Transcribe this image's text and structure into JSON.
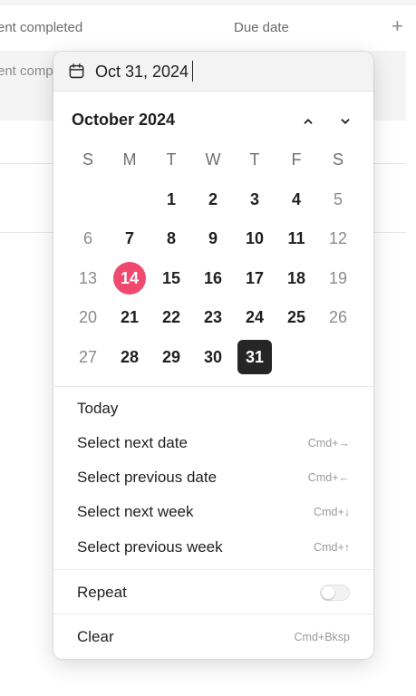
{
  "background": {
    "columns": {
      "col1": "ent completed",
      "col2": "Due date",
      "add_icon": "+"
    },
    "selected_row_text": "ent comp"
  },
  "datepicker": {
    "input_value": "Oct 31, 2024",
    "month_title": "October 2024",
    "weekdays": [
      "S",
      "M",
      "T",
      "W",
      "T",
      "F",
      "S"
    ],
    "days": {
      "d1": "1",
      "d2": "2",
      "d3": "3",
      "d4": "4",
      "d5": "5",
      "d6": "6",
      "d7": "7",
      "d8": "8",
      "d9": "9",
      "d10": "10",
      "d11": "11",
      "d12": "12",
      "d13": "13",
      "d14": "14",
      "d15": "15",
      "d16": "16",
      "d17": "17",
      "d18": "18",
      "d19": "19",
      "d20": "20",
      "d21": "21",
      "d22": "22",
      "d23": "23",
      "d24": "24",
      "d25": "25",
      "d26": "26",
      "d27": "27",
      "d28": "28",
      "d29": "29",
      "d30": "30",
      "d31": "31"
    },
    "today_day": "14",
    "selected_day": "31",
    "menu": {
      "today": "Today",
      "next_date": {
        "label": "Select next date",
        "shortcut": "Cmd+→"
      },
      "prev_date": {
        "label": "Select previous date",
        "shortcut": "Cmd+←"
      },
      "next_week": {
        "label": "Select next week",
        "shortcut": "Cmd+↓"
      },
      "prev_week": {
        "label": "Select previous week",
        "shortcut": "Cmd+↑"
      },
      "repeat": "Repeat",
      "clear": {
        "label": "Clear",
        "shortcut": "Cmd+Bksp"
      }
    },
    "colors": {
      "today_highlight": "#f0486f",
      "selected_bg": "#262626"
    }
  }
}
